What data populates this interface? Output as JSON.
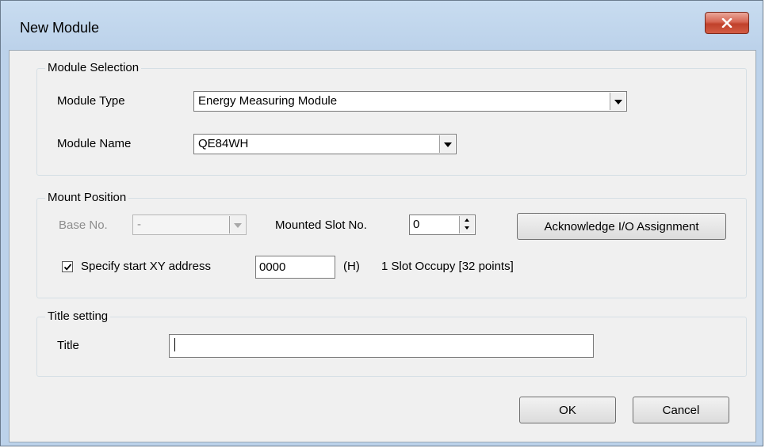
{
  "window": {
    "title": "New Module"
  },
  "module_selection": {
    "group_title": "Module Selection",
    "type_label": "Module Type",
    "type_value": "Energy Measuring Module",
    "name_label": "Module Name",
    "name_value": "QE84WH"
  },
  "mount_position": {
    "group_title": "Mount Position",
    "base_label": "Base No.",
    "base_value": "-",
    "slot_label": "Mounted Slot No.",
    "slot_value": "0",
    "ack_button": "Acknowledge I/O Assignment",
    "specify_label": "Specify start XY address",
    "specify_checked": true,
    "xy_value": "0000",
    "hex_label": "(H)",
    "occupy_text": "1 Slot Occupy [32 points]"
  },
  "title_setting": {
    "group_title": "Title setting",
    "title_label": "Title",
    "title_value": ""
  },
  "buttons": {
    "ok": "OK",
    "cancel": "Cancel"
  }
}
